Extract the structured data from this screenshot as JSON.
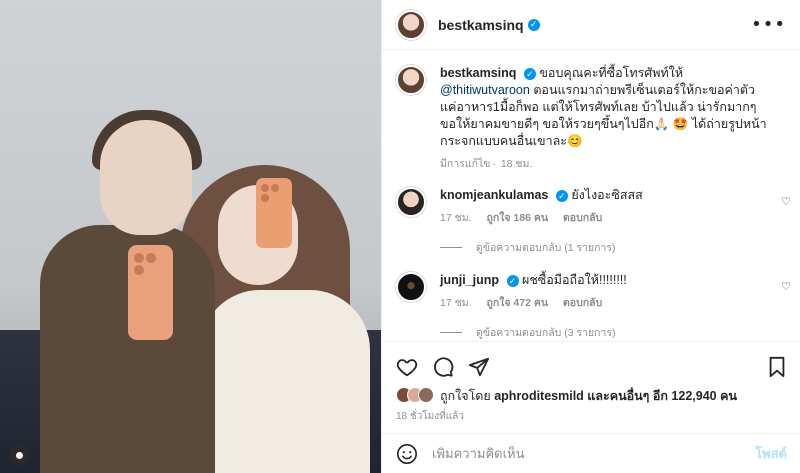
{
  "post": {
    "username": "bestkamsinq",
    "more_label": "•••"
  },
  "caption": {
    "username": "bestkamsinq",
    "text_pre": "ขอบคุณคะที่ซื้อโทรศัพท์ให้",
    "mention": "@thitiwutvaroon",
    "text_post": "ตอนแรกมาถ่ายพรีเซ็นเตอร์ให้กะขอค่าตัวแค่อาหาร1มื้อก็พอ แต่ให้โทรศัพท์เลย บ้าไปแล้ว น่ารักมากๆ ขอให้ยาคมขายดีๆ ขอให้รวยๆขึ้นๆไปอีก🙏🏻 🤩 ได้ถ่ายรูปหน้ากระจกแบบคนอื่นเขาละ😊",
    "edited": "มีการแก้ไข",
    "time": "18 ชม."
  },
  "comments": [
    {
      "username": "knomjeankulamas",
      "text": "ยังไงอะซิสสส",
      "time": "17 ชม.",
      "likes": "ถูกใจ 186 คน",
      "reply": "ตอบกลับ",
      "view_replies": "ดูข้อความตอบกลับ (1 รายการ)"
    },
    {
      "username": "junji_junp",
      "text": "ผชซื้อมือถือให้!!!!!!!!",
      "time": "17 ชม.",
      "likes": "ถูกใจ 472 คน",
      "reply": "ตอบกลับ",
      "view_replies": "ดูข้อความตอบกลับ (3 รายการ)"
    }
  ],
  "likes": {
    "prefix": "ถูกใจโดย",
    "user": "aphroditesmild",
    "suffix": "และคนอื่นๆ อีก 122,940 คน"
  },
  "posted_time": "18 ชั่วโมงที่แล้ว",
  "comment_input": {
    "placeholder": "เพิ่มความคิดเห็น",
    "post_label": "โพสต์"
  },
  "colors": {
    "accent": "#0095f6",
    "muted": "#8e8e8e",
    "text": "#262626"
  }
}
